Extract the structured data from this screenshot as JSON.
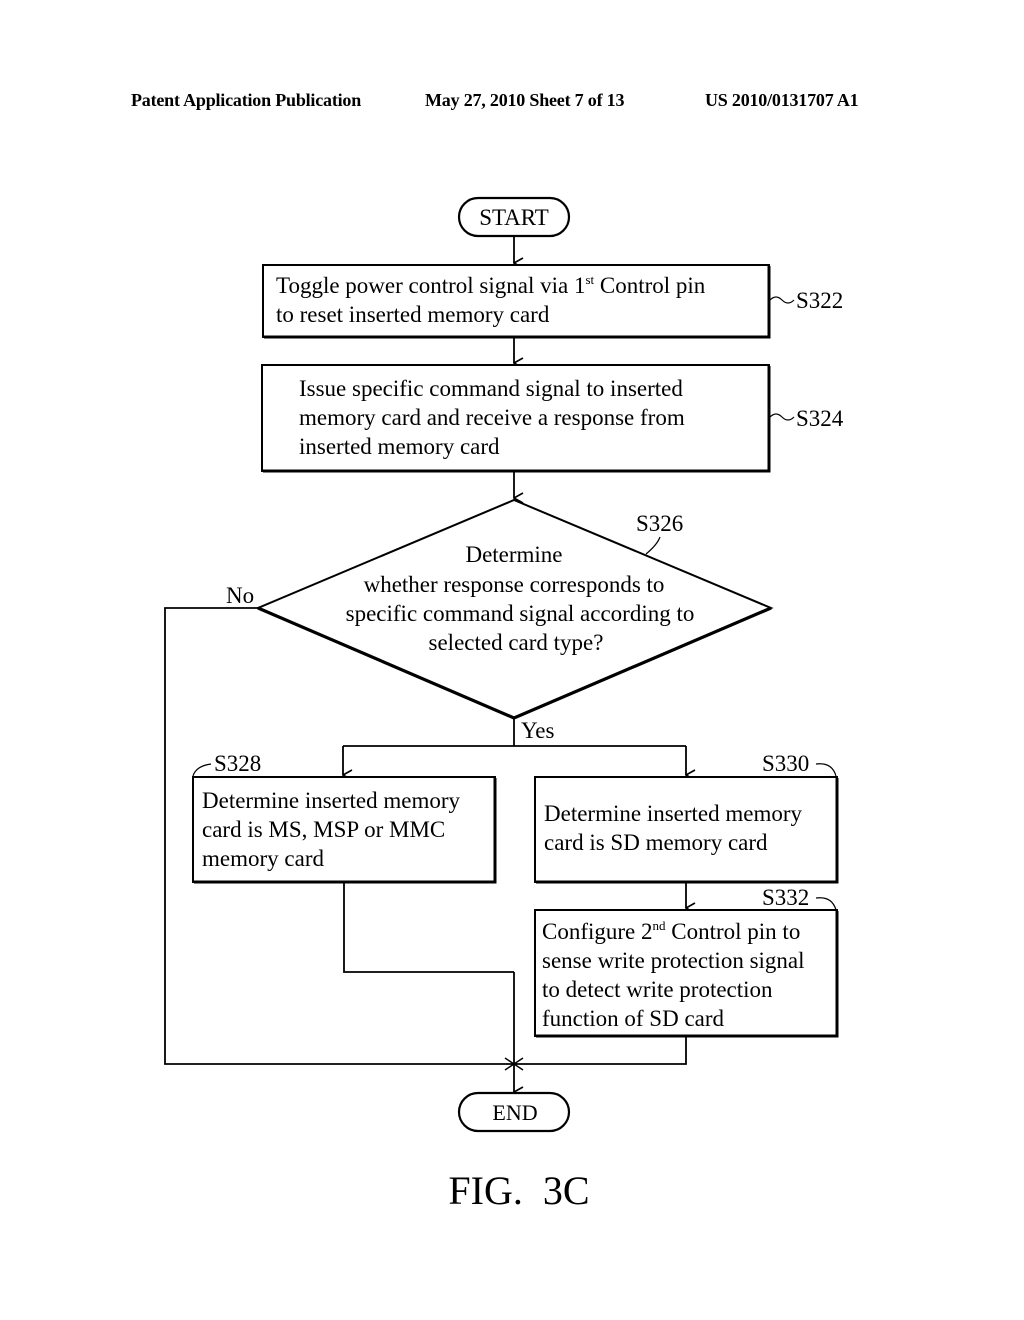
{
  "header": {
    "publication": "Patent Application Publication",
    "date_sheet": "May 27, 2010  Sheet 7 of 13",
    "number": "US 2010/0131707 A1"
  },
  "flowchart": {
    "start": "START",
    "end": "END",
    "steps": {
      "s322": {
        "id": "S322",
        "line1_pre": "Toggle power control signal via 1",
        "line1_sup": "st",
        "line1_post": " Control pin",
        "line2": "to reset inserted memory card"
      },
      "s324": {
        "id": "S324",
        "lines": [
          "Issue specific command signal to inserted",
          "memory card and receive a response from",
          "inserted memory card"
        ]
      },
      "s326": {
        "id": "S326",
        "lines": [
          "Determine",
          "whether response corresponds to",
          "specific command signal according to",
          "selected card type?"
        ],
        "no_label": "No",
        "yes_label": "Yes"
      },
      "s328": {
        "id": "S328",
        "lines": [
          "Determine inserted memory",
          "card is MS, MSP or MMC",
          "memory card"
        ]
      },
      "s330": {
        "id": "S330",
        "lines": [
          "Determine inserted memory",
          "card is SD memory card"
        ]
      },
      "s332": {
        "id": "S332",
        "line1_pre": "Configure 2",
        "line1_sup": "nd",
        "line1_post": " Control pin to",
        "lines": [
          "sense write protection signal",
          "to detect write protection",
          "function of SD card"
        ]
      }
    }
  },
  "figure_label": "FIG.  3C"
}
